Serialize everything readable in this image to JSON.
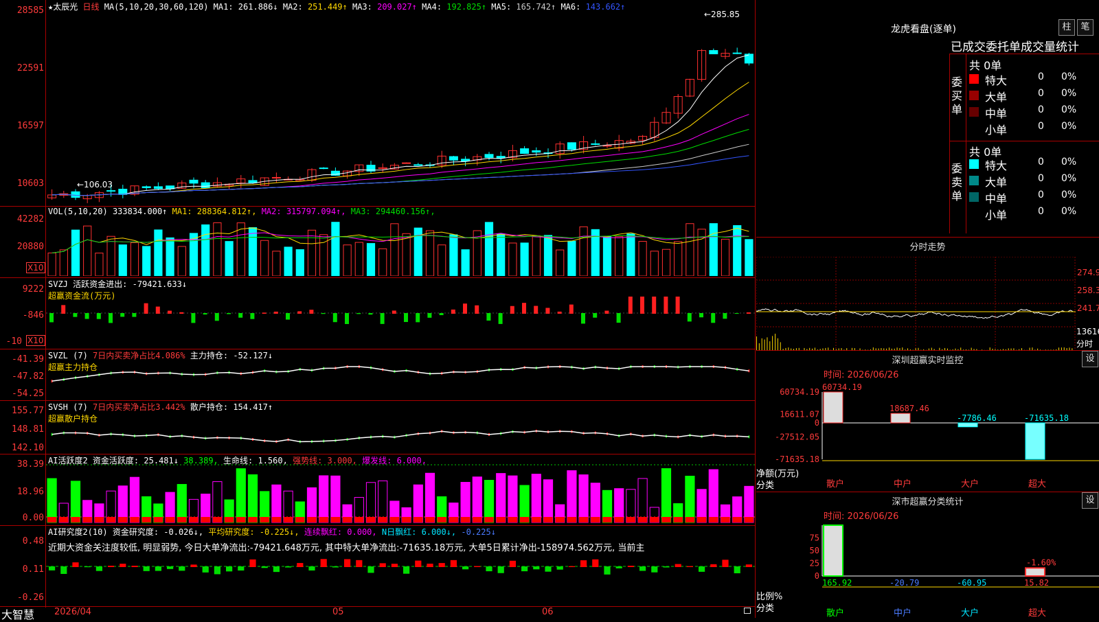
{
  "stock": {
    "name": "★太辰光",
    "period": "日线"
  },
  "kline": {
    "ma_label": "MA(5,10,20,30,60,120)",
    "ma": [
      {
        "name": "MA1",
        "value": "261.886↓",
        "color": "#ffffff"
      },
      {
        "name": "MA2",
        "value": "251.449↑",
        "color": "#ffd800"
      },
      {
        "name": "MA3",
        "value": "209.027↑",
        "color": "#ff00ff"
      },
      {
        "name": "MA4",
        "value": "192.825↑",
        "color": "#00dd00"
      },
      {
        "name": "MA5",
        "value": "165.742↑",
        "color": "#cccccc"
      },
      {
        "name": "MA6",
        "value": "143.662↑",
        "color": "#3355ff"
      }
    ],
    "yticks": [
      "28585",
      "22591",
      "16597",
      "10603"
    ],
    "high_label": "←285.85",
    "low_label": "←106.03"
  },
  "vol": {
    "title": "VOL(5,10,20)",
    "value": "333834.000↑",
    "ma": [
      {
        "name": "MA1",
        "value": "288364.812↑",
        "color": "#ffd800"
      },
      {
        "name": "MA2",
        "value": "315797.094↑",
        "color": "#ff00ff"
      },
      {
        "name": "MA3",
        "value": "294460.156↑",
        "color": "#00dd00"
      }
    ],
    "yticks": [
      "42282",
      "20880"
    ],
    "unit": "X10"
  },
  "svzj": {
    "title": "SVZJ",
    "label": "活跃资金进出:",
    "value": "-79421.633↓",
    "sub": "超赢资金流(万元)",
    "yticks": [
      "9222",
      "-846",
      "-10"
    ],
    "unit": "X10"
  },
  "svzl": {
    "title": "SVZL (7)",
    "ratio": "7日内买卖净占比4.086%",
    "label": "主力持仓:",
    "value": "-52.127↓",
    "sub": "超赢主力持仓",
    "yticks": [
      "-41.39",
      "-47.82",
      "-54.25"
    ]
  },
  "svsh": {
    "title": "SVSH (7)",
    "ratio": "7日内买卖净占比3.442%",
    "label": "散户持仓:",
    "value": "154.417↑",
    "sub": "超赢散户持仓",
    "yticks": [
      "155.77",
      "148.81",
      "142.10"
    ]
  },
  "ai1": {
    "title": "AI活跃度2",
    "label": "资金活跃度:",
    "v1": "25.481↓",
    "v2": "38.389,",
    "l3": "生命线:",
    "v3": "1.560,",
    "l4": "强势线:",
    "v4": "3.000,",
    "l5": "爆发线:",
    "v5": "6.000,",
    "yticks": [
      "38.39",
      "18.96",
      "0.00"
    ]
  },
  "ai2": {
    "title": "AI研究度2(10)",
    "l1": "资金研究度:",
    "v1": "-0.026↓,",
    "l2": "平均研究度:",
    "v2": "-0.225↓,",
    "l3": "连续飘红:",
    "v3": "0.000,",
    "l4": "N日飘红:",
    "v4": "6.000↓,",
    "v5": "-0.225↓",
    "text": "近期大资金关注度较低, 明显弱势, 今日大单净流出:-79421.648万元, 其中特大单净流出:-71635.18万元, 大单5日累计净出-158974.562万元, 当前主",
    "yticks": [
      "0.48",
      "0.11",
      "-0.26"
    ]
  },
  "bottom": {
    "brand": "大智慧",
    "date": "2026/04",
    "m5": "05",
    "m6": "06"
  },
  "lhb": {
    "title": "龙虎看盘(逐单)",
    "btn1": "柱",
    "btn2": "笔",
    "tabs": [
      "已成交",
      "委托单",
      "成交量统计"
    ],
    "buy": {
      "side": "委买单",
      "total": "共 0单",
      "rows": [
        {
          "name": "特大",
          "num": "0",
          "pct": "0%",
          "color": "#ff0000"
        },
        {
          "name": "大单",
          "num": "0",
          "pct": "0%",
          "color": "#990000"
        },
        {
          "name": "中单",
          "num": "0",
          "pct": "0%",
          "color": "#660000"
        },
        {
          "name": "小单",
          "num": "0",
          "pct": "0%",
          "color": "#000000"
        }
      ]
    },
    "sell": {
      "side": "委卖单",
      "total": "共 0单",
      "rows": [
        {
          "name": "特大",
          "num": "0",
          "pct": "0%",
          "color": "#00ffff"
        },
        {
          "name": "大单",
          "num": "0",
          "pct": "0%",
          "color": "#008a8a"
        },
        {
          "name": "中单",
          "num": "0",
          "pct": "0%",
          "color": "#006666"
        },
        {
          "name": "小单",
          "num": "0",
          "pct": "0%",
          "color": "#000000"
        }
      ]
    }
  },
  "intraday": {
    "title": "分时走势",
    "yticks": [
      "274.9",
      "258.3",
      "241.7",
      "13616"
    ],
    "unit": "分时"
  },
  "monitor": {
    "title": "深圳超赢实时监控",
    "btn": "设",
    "time": "时间: 2026/06/26",
    "yticks": [
      "60734.19",
      "16611.07",
      "0",
      "-27512.05",
      "-71635.18"
    ],
    "ylabel": "净额(万元)",
    "xlabel": "分类",
    "bars": [
      {
        "cat": "散户",
        "value": 60734.19,
        "label": "60734.19"
      },
      {
        "cat": "中户",
        "value": 18687.46,
        "label": "18687.46"
      },
      {
        "cat": "大户",
        "value": -7786.46,
        "label": "-7786.46"
      },
      {
        "cat": "超大",
        "value": -71635.18,
        "label": "-71635.18"
      }
    ]
  },
  "cls": {
    "title": "深市超赢分类统计",
    "btn": "设",
    "time": "时间: 2026/06/26",
    "yticks": [
      "75",
      "50",
      "25",
      "0"
    ],
    "ylabel": "比例%",
    "xlabel": "分类",
    "bars": [
      {
        "cat": "散户",
        "value": 165.92,
        "label": "165.92"
      },
      {
        "cat": "中户",
        "value": -20.79,
        "label": "-20.79"
      },
      {
        "cat": "大户",
        "value": -60.95,
        "label": "-60.95"
      },
      {
        "cat": "超大",
        "value": 15.82,
        "label": "15.82"
      }
    ],
    "note": "-1.60%"
  },
  "chart_data": {
    "type": "bar",
    "title": "深圳超赢实时监控",
    "categories": [
      "散户",
      "中户",
      "大户",
      "超大"
    ],
    "values": [
      60734.19,
      18687.46,
      -7786.46,
      -71635.18
    ],
    "ylabel": "净额(万元)",
    "xlabel": "分类",
    "ylim": [
      -71635.18,
      60734.19
    ]
  }
}
